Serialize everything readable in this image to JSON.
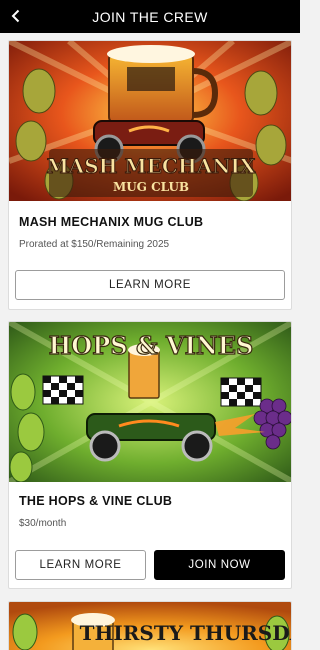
{
  "header": {
    "title": "JOIN THE CREW",
    "back_icon": "chevron-left-icon"
  },
  "clubs": [
    {
      "image_title": "MASH MECHANIX",
      "image_subtitle": "MUG CLUB",
      "name": "MASH MECHANIX MUG CLUB",
      "price": "Prorated at $150/Remaining 2025",
      "learn_label": "LEARN MORE"
    },
    {
      "image_title": "HOPS & VINES",
      "name": "THE HOPS & VINE CLUB",
      "price": "$30/month",
      "learn_label": "LEARN MORE",
      "join_label": "JOIN NOW"
    },
    {
      "image_title": "THIRSTY THURSDAY"
    }
  ],
  "colors": {
    "header_bg": "#000000",
    "primary_button": "#000000",
    "accent_orange": "#e8561c",
    "hop_green": "#7fb23a"
  }
}
